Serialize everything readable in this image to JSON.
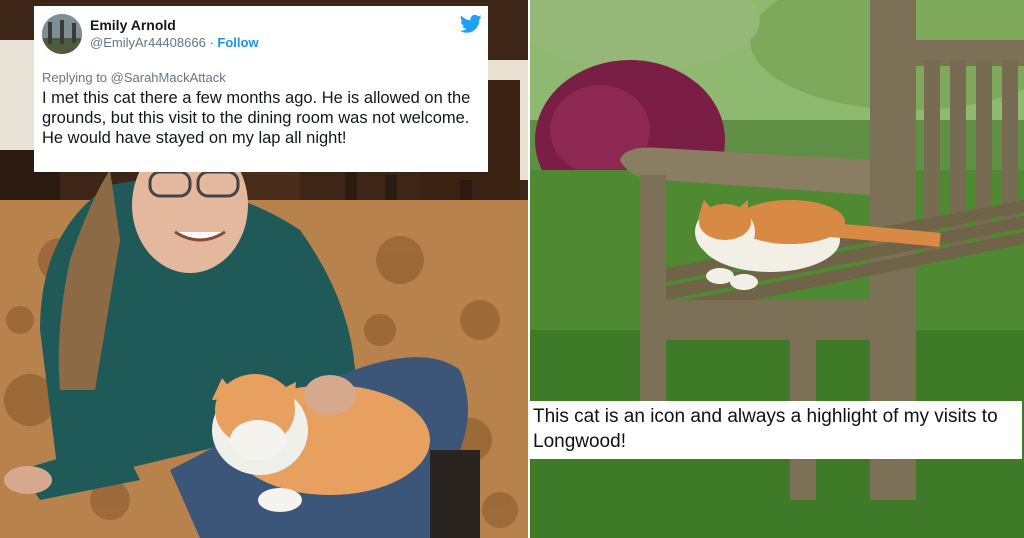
{
  "tweet": {
    "display_name": "Emily Arnold",
    "handle": "@EmilyAr44408666",
    "separator": "·",
    "follow_label": "Follow",
    "replying_to": "Replying to @SarahMackAttack",
    "text": "I met this cat there a few months ago. He is allowed on the grounds, but this visit to the dining room was not welcome. He would have stayed on my lap all night!",
    "brand_icon": "twitter-bird-icon",
    "link_color": "#1b95e0"
  },
  "photos": {
    "left_scene": "woman-with-cat-on-lap",
    "right_scene": "cat-on-garden-bench"
  },
  "caption": {
    "text": "This cat is an icon and always a highlight of my visits to Longwood!"
  }
}
